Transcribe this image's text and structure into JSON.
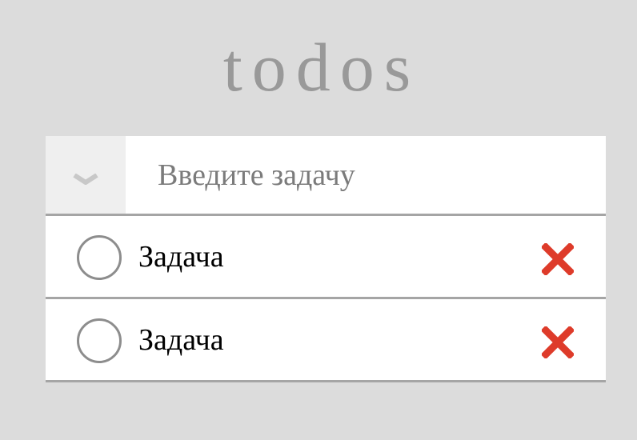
{
  "app": {
    "title": "todos"
  },
  "new_todo": {
    "placeholder": "Введите задачу",
    "value": ""
  },
  "todos": [
    {
      "text": "Задача",
      "completed": false
    },
    {
      "text": "Задача",
      "completed": false
    }
  ],
  "icons": {
    "toggle_all": "chevron-down-icon",
    "delete": "close-x-icon"
  },
  "colors": {
    "background": "#dcdcdc",
    "title": "#999999",
    "delete": "#de3b2a",
    "divider": "#a5a5a5"
  }
}
